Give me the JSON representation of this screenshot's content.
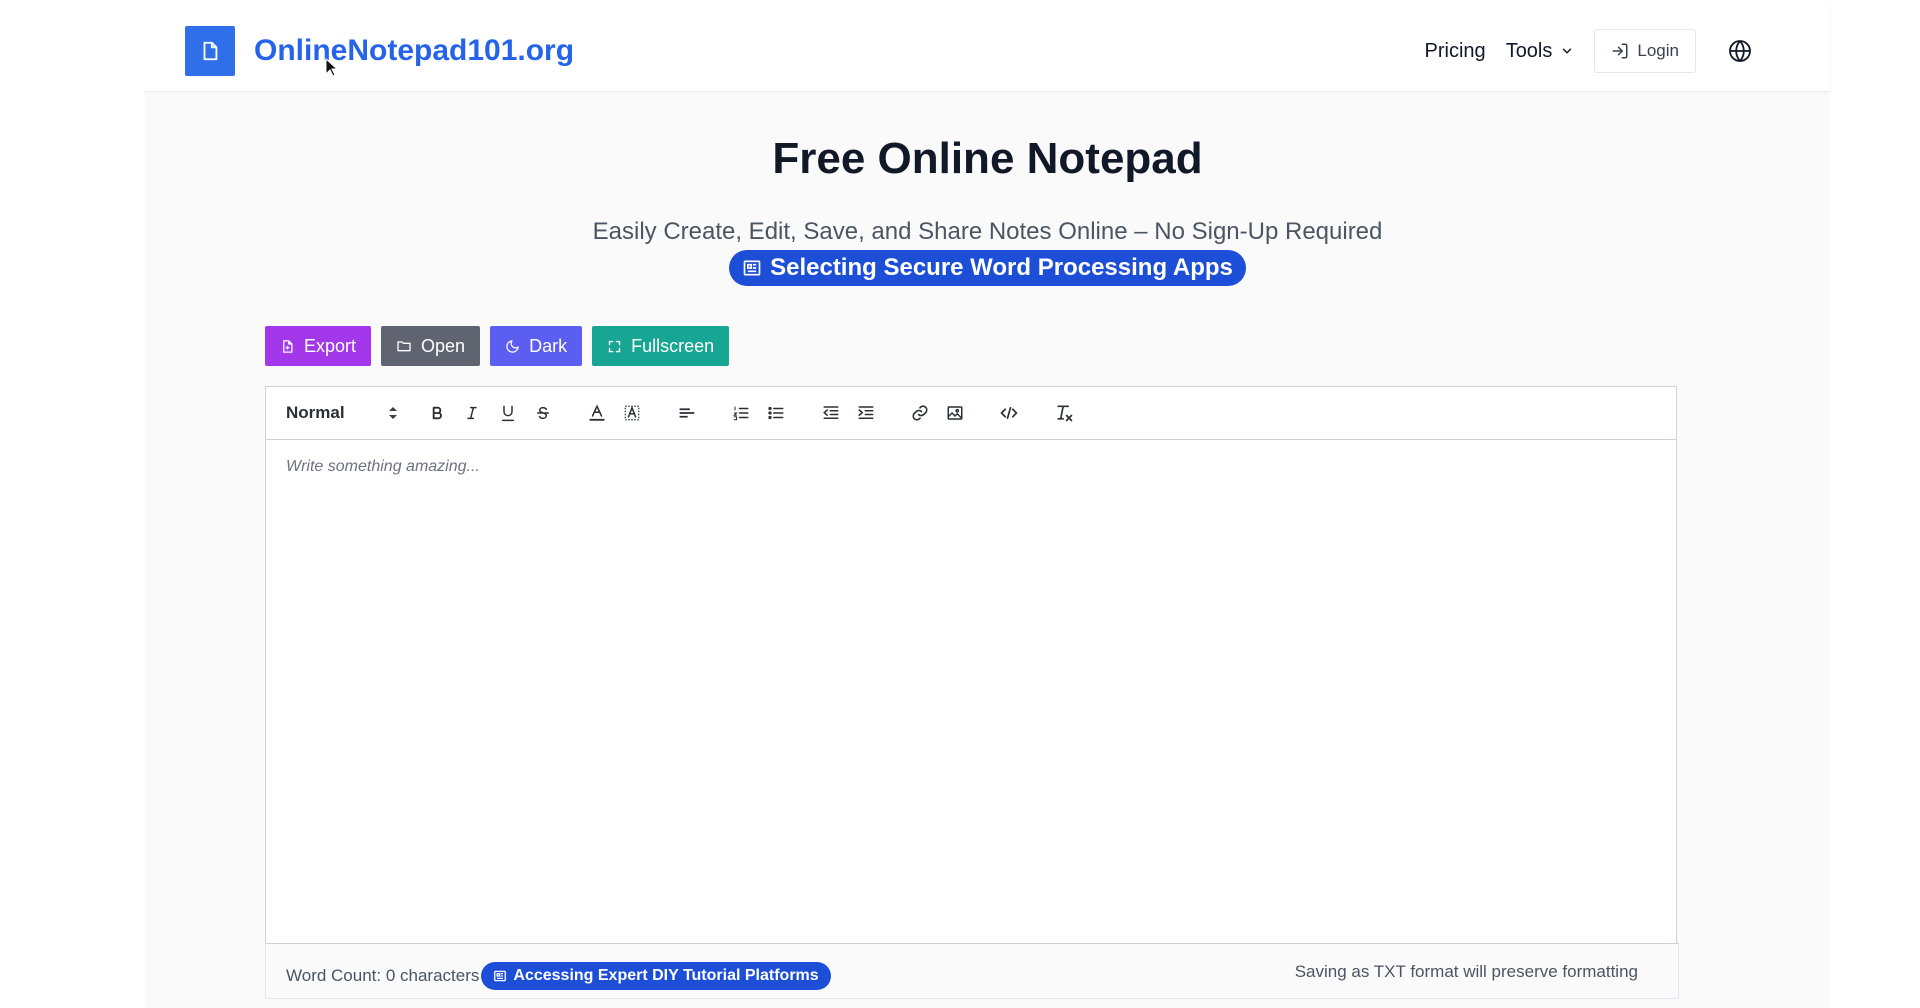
{
  "header": {
    "logo_text": "OnlineNotepad101.org",
    "nav": {
      "pricing": "Pricing",
      "tools": "Tools",
      "login": "Login"
    }
  },
  "hero": {
    "title": "Free Online Notepad",
    "subtitle": "Easily Create, Edit, Save, and Share Notes Online – No Sign-Up Required",
    "promo_link": "Selecting Secure Word Processing Apps"
  },
  "actions": {
    "export": "Export",
    "open": "Open",
    "dark": "Dark",
    "fullscreen": "Fullscreen"
  },
  "editor": {
    "format_select": "Normal",
    "placeholder": "Write something amazing...",
    "word_count": "Word Count: 0 characters",
    "footer_link": "Accessing Expert DIY Tutorial Platforms",
    "save_note": "Saving as TXT format will preserve formatting"
  },
  "colors": {
    "brand": "#2563eb",
    "export": "#a338ea",
    "open": "#5f6470",
    "dark": "#5b5ef0",
    "fullscreen": "#17a693",
    "pill": "#1d4ed8"
  }
}
